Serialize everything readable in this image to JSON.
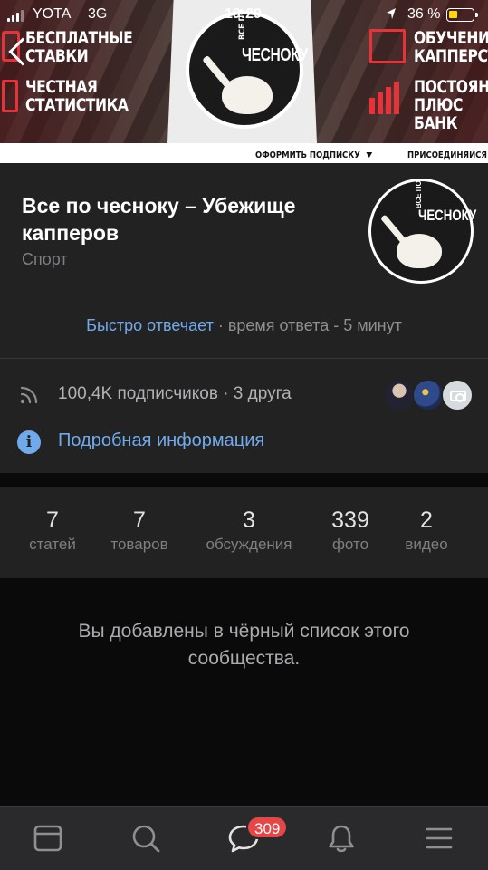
{
  "status_bar": {
    "carrier": "YOTA",
    "network": "3G",
    "time": "19:29",
    "battery_percent": "36 %",
    "battery_level": 0.36,
    "battery_color": "#ffd60a"
  },
  "cover": {
    "promo_left": [
      "БЕСПЛАТНЫЕ СТАВКИ",
      "ЧЕСТНАЯ СТАТИСТИКА"
    ],
    "promo_right": [
      "ОБУЧЕНИЕ КАППЕРСТВ",
      "ПОСТОЯННЫ ПЛЮС БАНК"
    ],
    "logo_small": "ВСЕ ПО",
    "logo_big": "ЧЕСНОКУ",
    "subscribe_link": "ОФОРМИТЬ ПОДПИСКУ",
    "join_link": "ПРИСОЕДИНЯЙСЯ!"
  },
  "group": {
    "title": "Все по чесноку – Убежище капперов",
    "category": "Спорт",
    "avatar_logo_small": "ВСЕ ПО",
    "avatar_logo_big": "ЧЕСНОКУ",
    "response_fast": "Быстро отвечает",
    "response_rest": " · время ответа - 5 минут",
    "subscribers": "100,4K подписчиков · 3 друга",
    "details_link": "Подробная информация"
  },
  "counters": [
    {
      "value": "7",
      "label": "статей"
    },
    {
      "value": "7",
      "label": "товаров"
    },
    {
      "value": "3",
      "label": "обсуждения"
    },
    {
      "value": "339",
      "label": "фото"
    },
    {
      "value": "2",
      "label": "видео"
    }
  ],
  "blocked_message": "Вы добавлены в чёрный список этого сообщества.",
  "tab_bar": {
    "icons": [
      "news-icon",
      "search-icon",
      "messages-icon",
      "notifications-icon",
      "menu-icon"
    ],
    "messages_badge": "309"
  },
  "colors": {
    "accent": "#71aaeb",
    "badge": "#e64646",
    "card_bg": "#222222",
    "page_bg": "#0a0a0a"
  }
}
